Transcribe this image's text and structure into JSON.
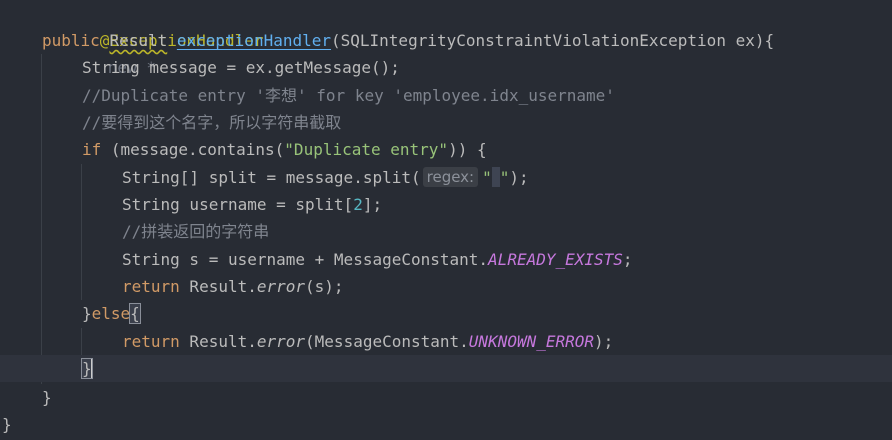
{
  "editor": {
    "lines": [
      {
        "annotation": "@ExceptionHandler",
        "hint": "new *"
      },
      {
        "k1": "public",
        "t1": "Result",
        "f1": "exceptionHandler",
        "p1": "(SQLIntegrityConstraintViolationException ex){"
      },
      {
        "a": "String message = ex.getMessage();"
      },
      {
        "c": "//Duplicate entry '李想' for key 'employee.idx_username'"
      },
      {
        "c": "//要得到这个名字，所以字符串截取"
      },
      {
        "k": "if",
        "a": " (message.contains(",
        "s": "\"Duplicate entry\"",
        "b": ")) {"
      },
      {
        "a": "String[] split = message.split(",
        "hint": "regex:",
        "s1": "\"",
        "s2": "\"",
        "b": ");"
      },
      {
        "a": "String username = split[",
        "n": "2",
        "b": "];"
      },
      {
        "c": "//拼装返回的字符串"
      },
      {
        "a": "String s = username + MessageConstant.",
        "const": "ALREADY_EXISTS",
        "b": ";"
      },
      {
        "k": "return",
        "a": " Result.",
        "m": "error",
        "b": "(s);"
      },
      {
        "a": "}",
        "k": "else",
        "b": "{"
      },
      {
        "k": "return",
        "a": " Result.",
        "m": "error",
        "b1": "(MessageConstant.",
        "const": "UNKNOWN_ERROR",
        "b2": ");"
      },
      {
        "a": "}"
      },
      {
        "a": "}"
      },
      {
        "a": "}"
      }
    ]
  },
  "colors": {
    "background": "#282c34",
    "keyword": "#d19a66",
    "annotation": "#bbb529",
    "function": "#61afef",
    "comment": "#7f848e",
    "string": "#98c379",
    "number": "#56b6c2",
    "constant": "#c678dd"
  }
}
